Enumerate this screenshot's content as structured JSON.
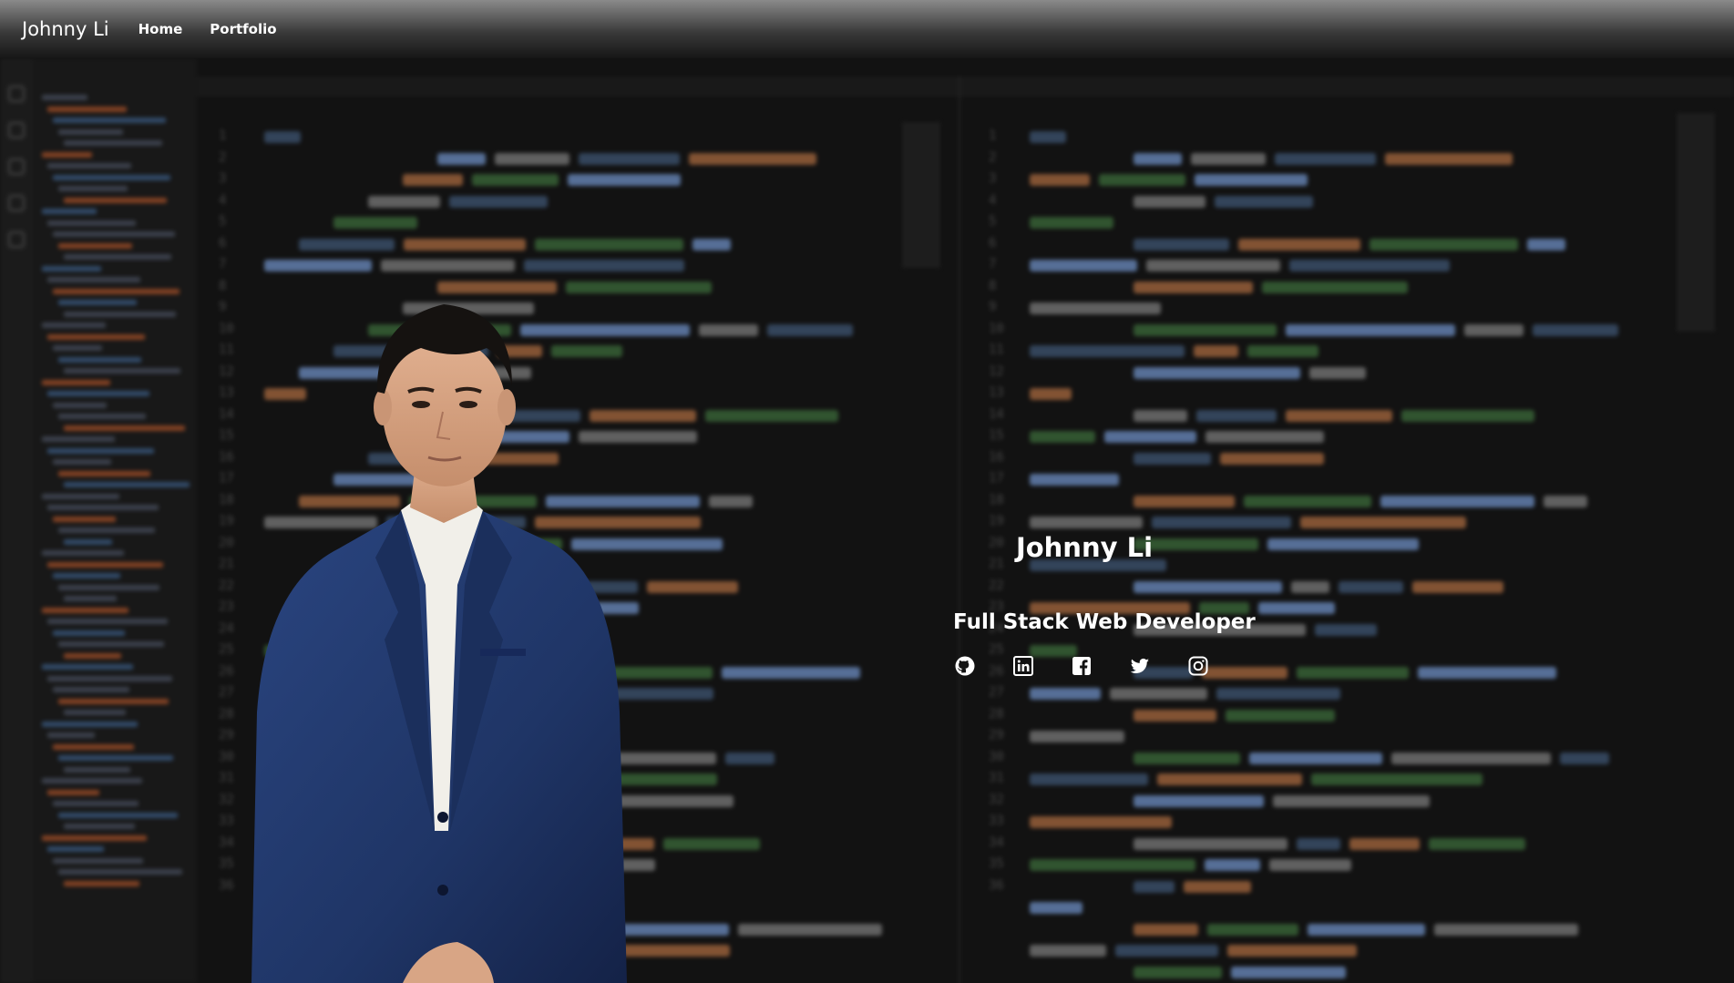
{
  "nav": {
    "brand": "Johnny Li",
    "links": [
      {
        "label": "Home"
      },
      {
        "label": "Portfolio"
      }
    ]
  },
  "hero": {
    "name": "Johnny Li",
    "title": "Full Stack Web Developer",
    "socials": [
      {
        "icon": "github-icon"
      },
      {
        "icon": "linkedin-icon"
      },
      {
        "icon": "facebook-icon"
      },
      {
        "icon": "twitter-icon"
      },
      {
        "icon": "instagram-icon"
      }
    ]
  },
  "colors": {
    "navbar_top": "#8a8a8a",
    "navbar_bottom": "#161616",
    "background": "#141414",
    "text": "#ffffff",
    "suit": "#1f3566"
  }
}
